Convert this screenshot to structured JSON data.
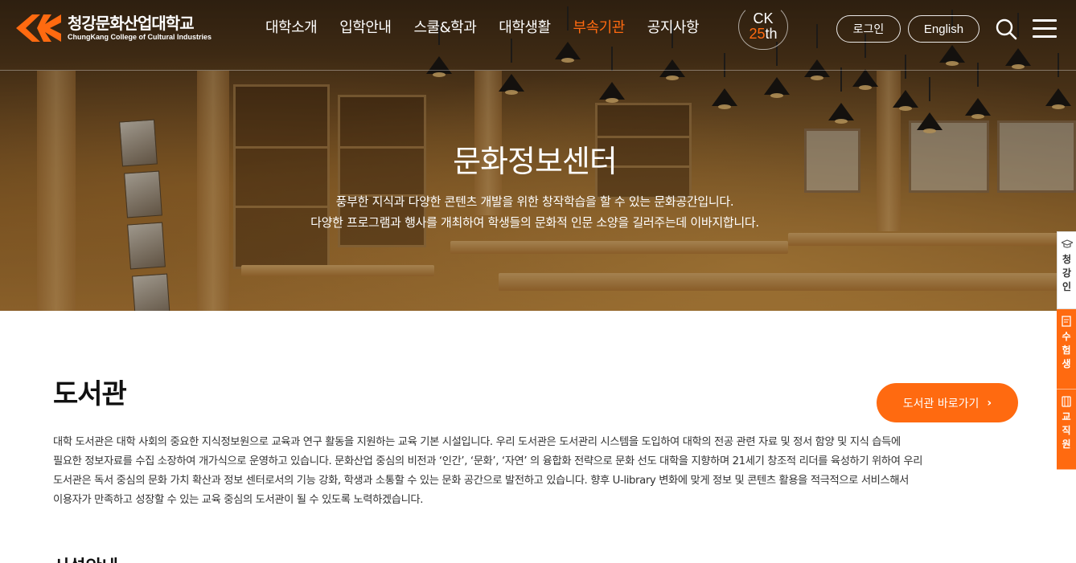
{
  "header": {
    "logo": {
      "korean": "청강문화산업대학교",
      "english": "ChungKang College of Cultural Industries"
    },
    "nav": [
      {
        "label": "대학소개",
        "active": false
      },
      {
        "label": "입학안내",
        "active": false
      },
      {
        "label": "스쿨&학과",
        "active": false
      },
      {
        "label": "대학생활",
        "active": false
      },
      {
        "label": "부속기관",
        "active": true
      },
      {
        "label": "공지사항",
        "active": false
      }
    ],
    "anniversary": {
      "top": "CK",
      "num": "25",
      "suffix": "th"
    },
    "login_label": "로그인",
    "language_label": "English",
    "icons": {
      "search": "search-icon",
      "menu": "hamburger-menu-icon"
    }
  },
  "hero": {
    "title": "문화정보센터",
    "subtitle_line1": "풍부한 지식과 다양한 콘텐츠 개발을 위한 창작학습을 할 수 있는 문화공간입니다.",
    "subtitle_line2": "다양한 프로그램과 행사를 개최하여 학생들의 문화적 인문 소양을 길러주는데 이바지합니다."
  },
  "quick_menu": [
    {
      "label": "청강인",
      "icon": "graduation-cap-icon",
      "style": "white"
    },
    {
      "label": "수험생",
      "icon": "note-icon",
      "style": "orange"
    },
    {
      "label": "교직원",
      "icon": "id-card-icon",
      "style": "orange"
    }
  ],
  "content": {
    "section_title": "도서관",
    "library_button": "도서관 바로가기",
    "description_lines": [
      "대학 도서관은 대학 사회의 중요한 지식정보원으로 교육과 연구 활동을 지원하는 교육 기본 시설입니다. 우리 도서관은 도서관리 시스템을 도입하여 대학의 전공 관련 자료 및 정서 함양 및 지식 습득에",
      "필요한 정보자료를 수집 소장하여 개가식으로 운영하고 있습니다. 문화산업 중심의 비전과 ‘인간’, ‘문화’, ‘자연’ 의 융합화 전략으로 문화 선도 대학을 지향하며 21세기 창조적 리더를 육성하기 위하여 우리",
      "도서관은 독서 중심의 문화 가치 확산과 정보 센터로서의 기능 강화, 학생과 소통할 수 있는 문화 공간으로 발전하고 있습니다. 향후 U-library 변화에 맞게 정보 및 콘텐츠 활용을 적극적으로 서비스해서",
      "이용자가 만족하고 성장할 수 있는 교육 중심의 도서관이 될 수 있도록 노력하겠습니다."
    ],
    "next_section_title": "시설안내"
  },
  "colors": {
    "accent": "#ff6a10",
    "text": "#333333",
    "heading": "#111111"
  }
}
